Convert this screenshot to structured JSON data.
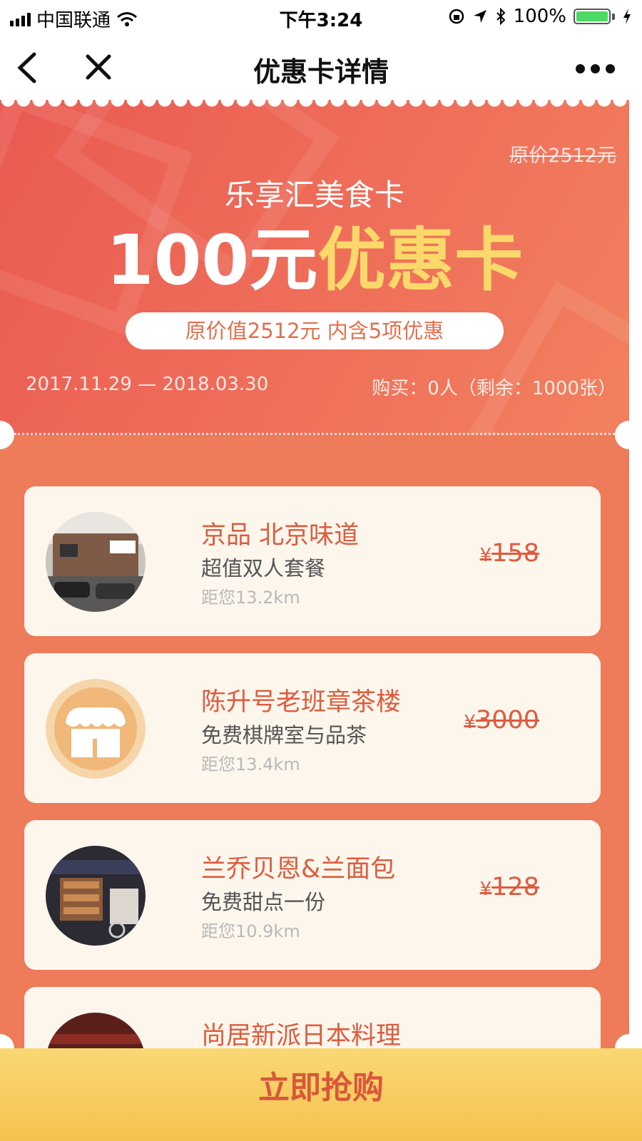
{
  "status_bar": {
    "carrier": "中国联通",
    "time": "下午3:24",
    "battery": "100%"
  },
  "nav": {
    "title": "优惠卡详情"
  },
  "card": {
    "original_price": "原价2512元",
    "name": "乐享汇美食卡",
    "headline_amount": "100元",
    "headline_label": "优惠卡",
    "summary": "原价值2512元 内含5项优惠",
    "validity": "2017.11.29 — 2018.03.30",
    "purchase_info": "购买：0人（剩余：1000张）"
  },
  "items": [
    {
      "name": "京品 北京味道",
      "desc": "超值双人套餐",
      "distance": "距您13.2km",
      "currency": "¥",
      "price": "158"
    },
    {
      "name": "陈升号老班章茶楼",
      "desc": "免费棋牌室与品茶",
      "distance": "距您13.4km",
      "currency": "¥",
      "price": "3000"
    },
    {
      "name": "兰乔贝恩&兰面包",
      "desc": "免费甜点一份",
      "distance": "距您10.9km",
      "currency": "¥",
      "price": "128"
    },
    {
      "name": "尚居新派日本料理",
      "desc": "",
      "distance": "",
      "currency": "",
      "price": ""
    }
  ],
  "buy_button": "立即抢购",
  "colors": {
    "accent": "#dd5c3e",
    "card_bg": "#ee7b59",
    "highlight": "#fbd86a",
    "button": "#f5c24e"
  }
}
